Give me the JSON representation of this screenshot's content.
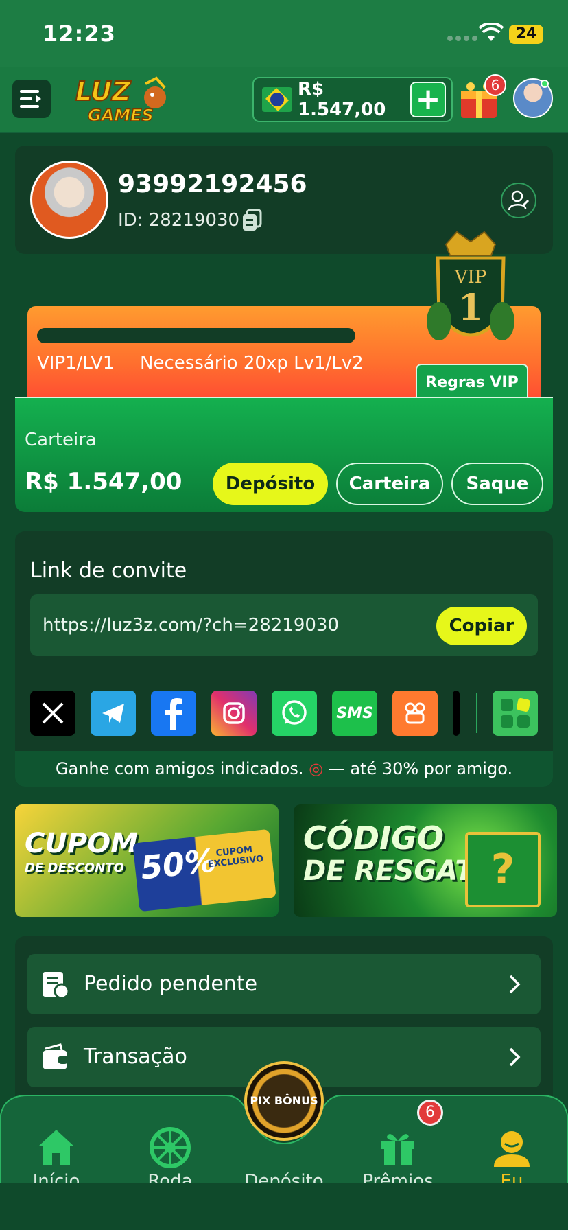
{
  "status_bar": {
    "time": "12:23",
    "battery": "24"
  },
  "header": {
    "logo_alt": "LUZ GAMES",
    "balance": "R$ 1.547,00",
    "plus": "+",
    "gift_badge": "6"
  },
  "profile": {
    "name": "93992192456",
    "id": "ID: 28219030"
  },
  "vip": {
    "level": "VIP1/LV1",
    "requirement": "Necessário 20xp Lv1/Lv2",
    "rules_button": "Regras VIP",
    "badge_text": "VIP",
    "badge_number": "1",
    "progress": 0
  },
  "wallet": {
    "label": "Carteira",
    "amount": "R$ 1.547,00",
    "deposit_button": "Depósito",
    "wallet_button": "Carteira",
    "withdraw_button": "Saque"
  },
  "invite": {
    "title": "Link de convite",
    "url": "https://luz3z.com/?ch=28219030",
    "copy_button": "Copiar",
    "socials": [
      "x-icon",
      "telegram-icon",
      "facebook-icon",
      "instagram-icon",
      "whatsapp-icon",
      "sms-icon",
      "kwai-icon",
      "tiktok-icon",
      "more-apps-icon"
    ],
    "sms_label": "SMS",
    "footer_before": "Ganhe com amigos indicados.",
    "footer_after": "— até 30% por amigo."
  },
  "banners": {
    "coupon_title_1": "CUPOM",
    "coupon_title_2": "DE DESCONTO",
    "coupon_pct": "50%",
    "coupon_side": "CUPOM EXCLUSIVO",
    "redeem_title_1": "CÓDIGO",
    "redeem_title_2": "DE RESGATE",
    "redeem_symbol": "?"
  },
  "list": {
    "items": [
      {
        "label": "Pedido pendente",
        "icon": "pending-order-icon"
      },
      {
        "label": "Transação",
        "icon": "wallet-icon"
      }
    ]
  },
  "bottom_nav": {
    "items": [
      {
        "label": "Início",
        "icon": "home-icon"
      },
      {
        "label": "Roda",
        "icon": "wheel-icon"
      },
      {
        "label": "Depósito",
        "icon": "pix-bonus-icon"
      },
      {
        "label": "Prêmios",
        "icon": "gift-icon"
      },
      {
        "label": "Eu",
        "icon": "user-icon"
      }
    ],
    "pix_label": "PIX BÔNUS",
    "prizes_badge": "6",
    "active_color": "#f2c21b"
  },
  "colors": {
    "background": "#0f4a2b",
    "header": "#1a7a41",
    "card": "#123d26",
    "accent_yellow": "#e6f71a",
    "vip_orange": "#ff7a2e"
  }
}
